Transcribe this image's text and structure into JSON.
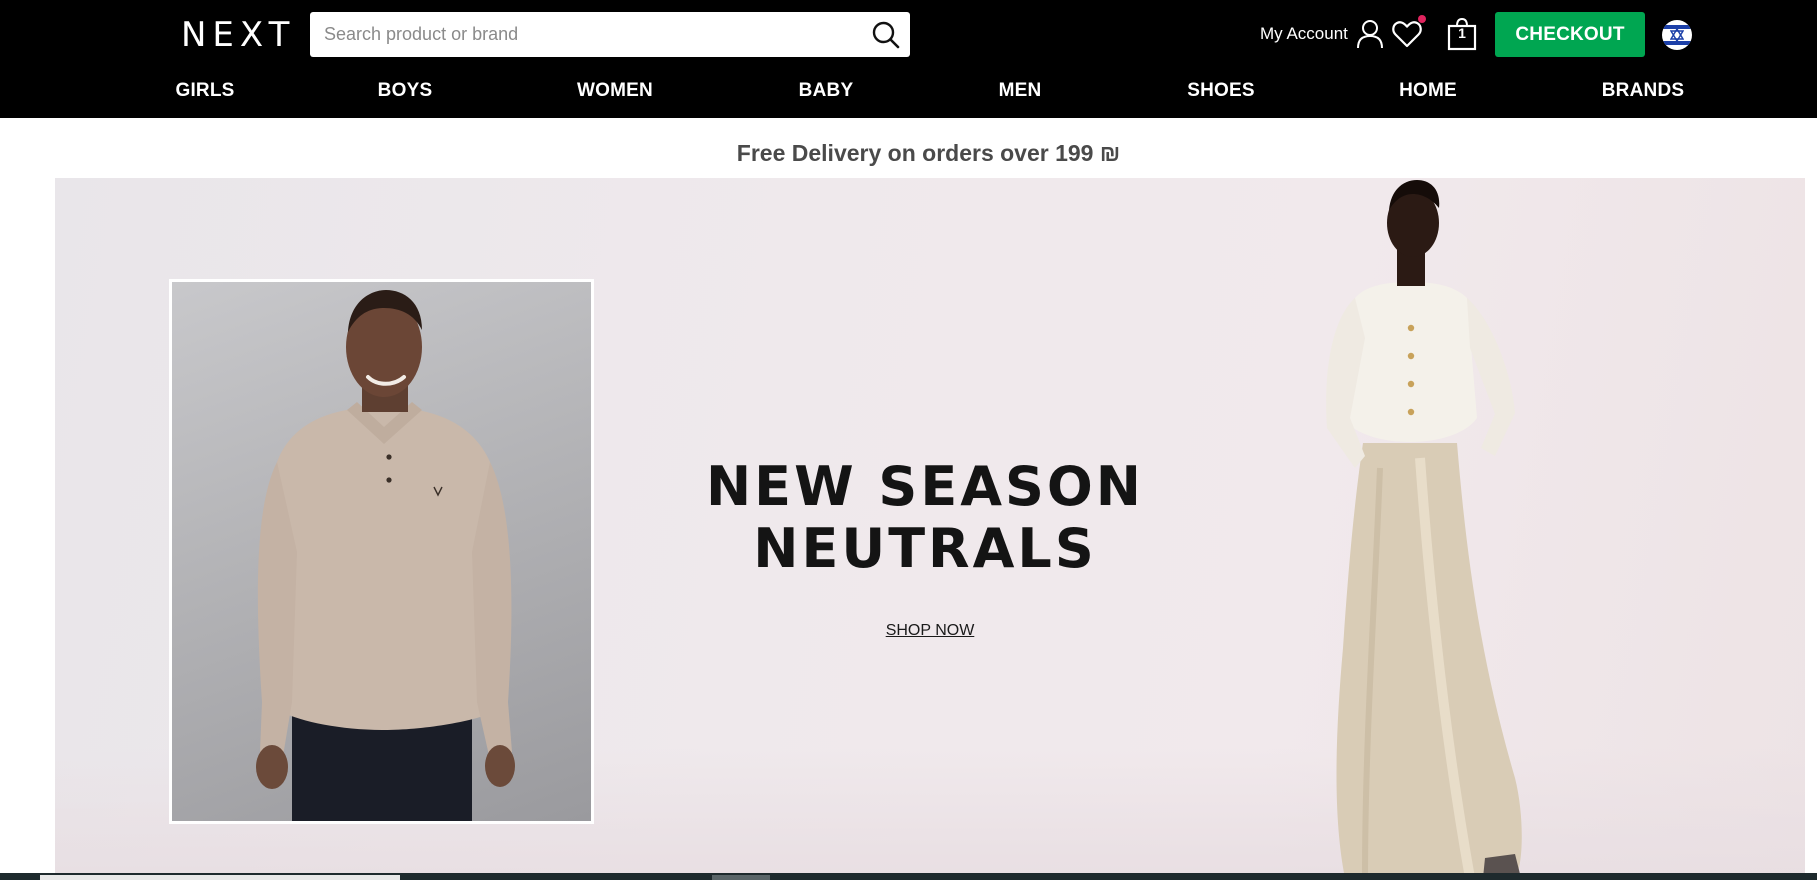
{
  "header": {
    "logo": "NEXT",
    "search_placeholder": "Search product or brand",
    "account_label": "My Account",
    "bag_count": "1",
    "checkout_label": "CHECKOUT"
  },
  "nav": {
    "items": [
      {
        "label": "GIRLS"
      },
      {
        "label": "BOYS"
      },
      {
        "label": "WOMEN"
      },
      {
        "label": "BABY"
      },
      {
        "label": "MEN"
      },
      {
        "label": "SHOES"
      },
      {
        "label": "HOME"
      },
      {
        "label": "BRANDS"
      }
    ]
  },
  "promo": {
    "delivery_text": "Free Delivery on orders over 199 ₪"
  },
  "hero": {
    "headline_line1": "NEW SEASON",
    "headline_line2": "NEUTRALS",
    "cta": "SHOP NOW"
  },
  "colors": {
    "header_bg": "#000000",
    "checkout_green": "#00a651",
    "wishlist_dot": "#e0245e",
    "hero_bg": "#efe9ec"
  },
  "icons": {
    "search": "search-icon",
    "account": "user-icon",
    "wishlist": "heart-icon",
    "bag": "shopping-bag-icon",
    "country": "israel-flag-icon"
  }
}
